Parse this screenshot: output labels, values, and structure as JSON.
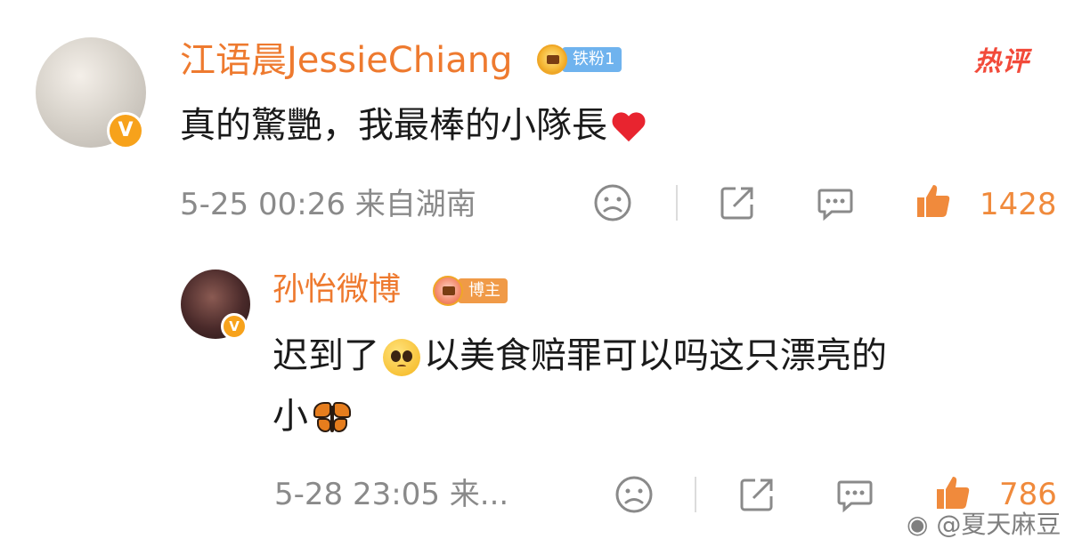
{
  "comment": {
    "author": "江语晨JessieChiang",
    "fan_badge": "铁粉1",
    "hot_tag": "热评",
    "text": "真的驚艷，我最棒的小隊長",
    "timestamp": "5-25 00:26",
    "location": "来自湖南",
    "likes": "1428"
  },
  "reply": {
    "author": "孙怡微博",
    "badge": "博主",
    "text_line1": "迟到了",
    "text_line1_rest": "以美食赔罪可以吗这只漂亮的",
    "text_line2": "小",
    "timestamp": "5-28 23:05",
    "location": "来...",
    "likes": "786"
  },
  "watermark": "@夏天麻豆",
  "colors": {
    "name": "#ee7a2f",
    "like": "#f08a3c",
    "hot": "#f24a3a",
    "meta": "#8a8a8a"
  },
  "icons": [
    "verified-v-icon",
    "crown-badge-icon",
    "dislike-face-icon",
    "share-icon",
    "comment-icon",
    "thumbs-up-icon",
    "heart-emoji",
    "pleading-face-emoji",
    "butterfly-emoji",
    "weibo-logo-icon"
  ]
}
